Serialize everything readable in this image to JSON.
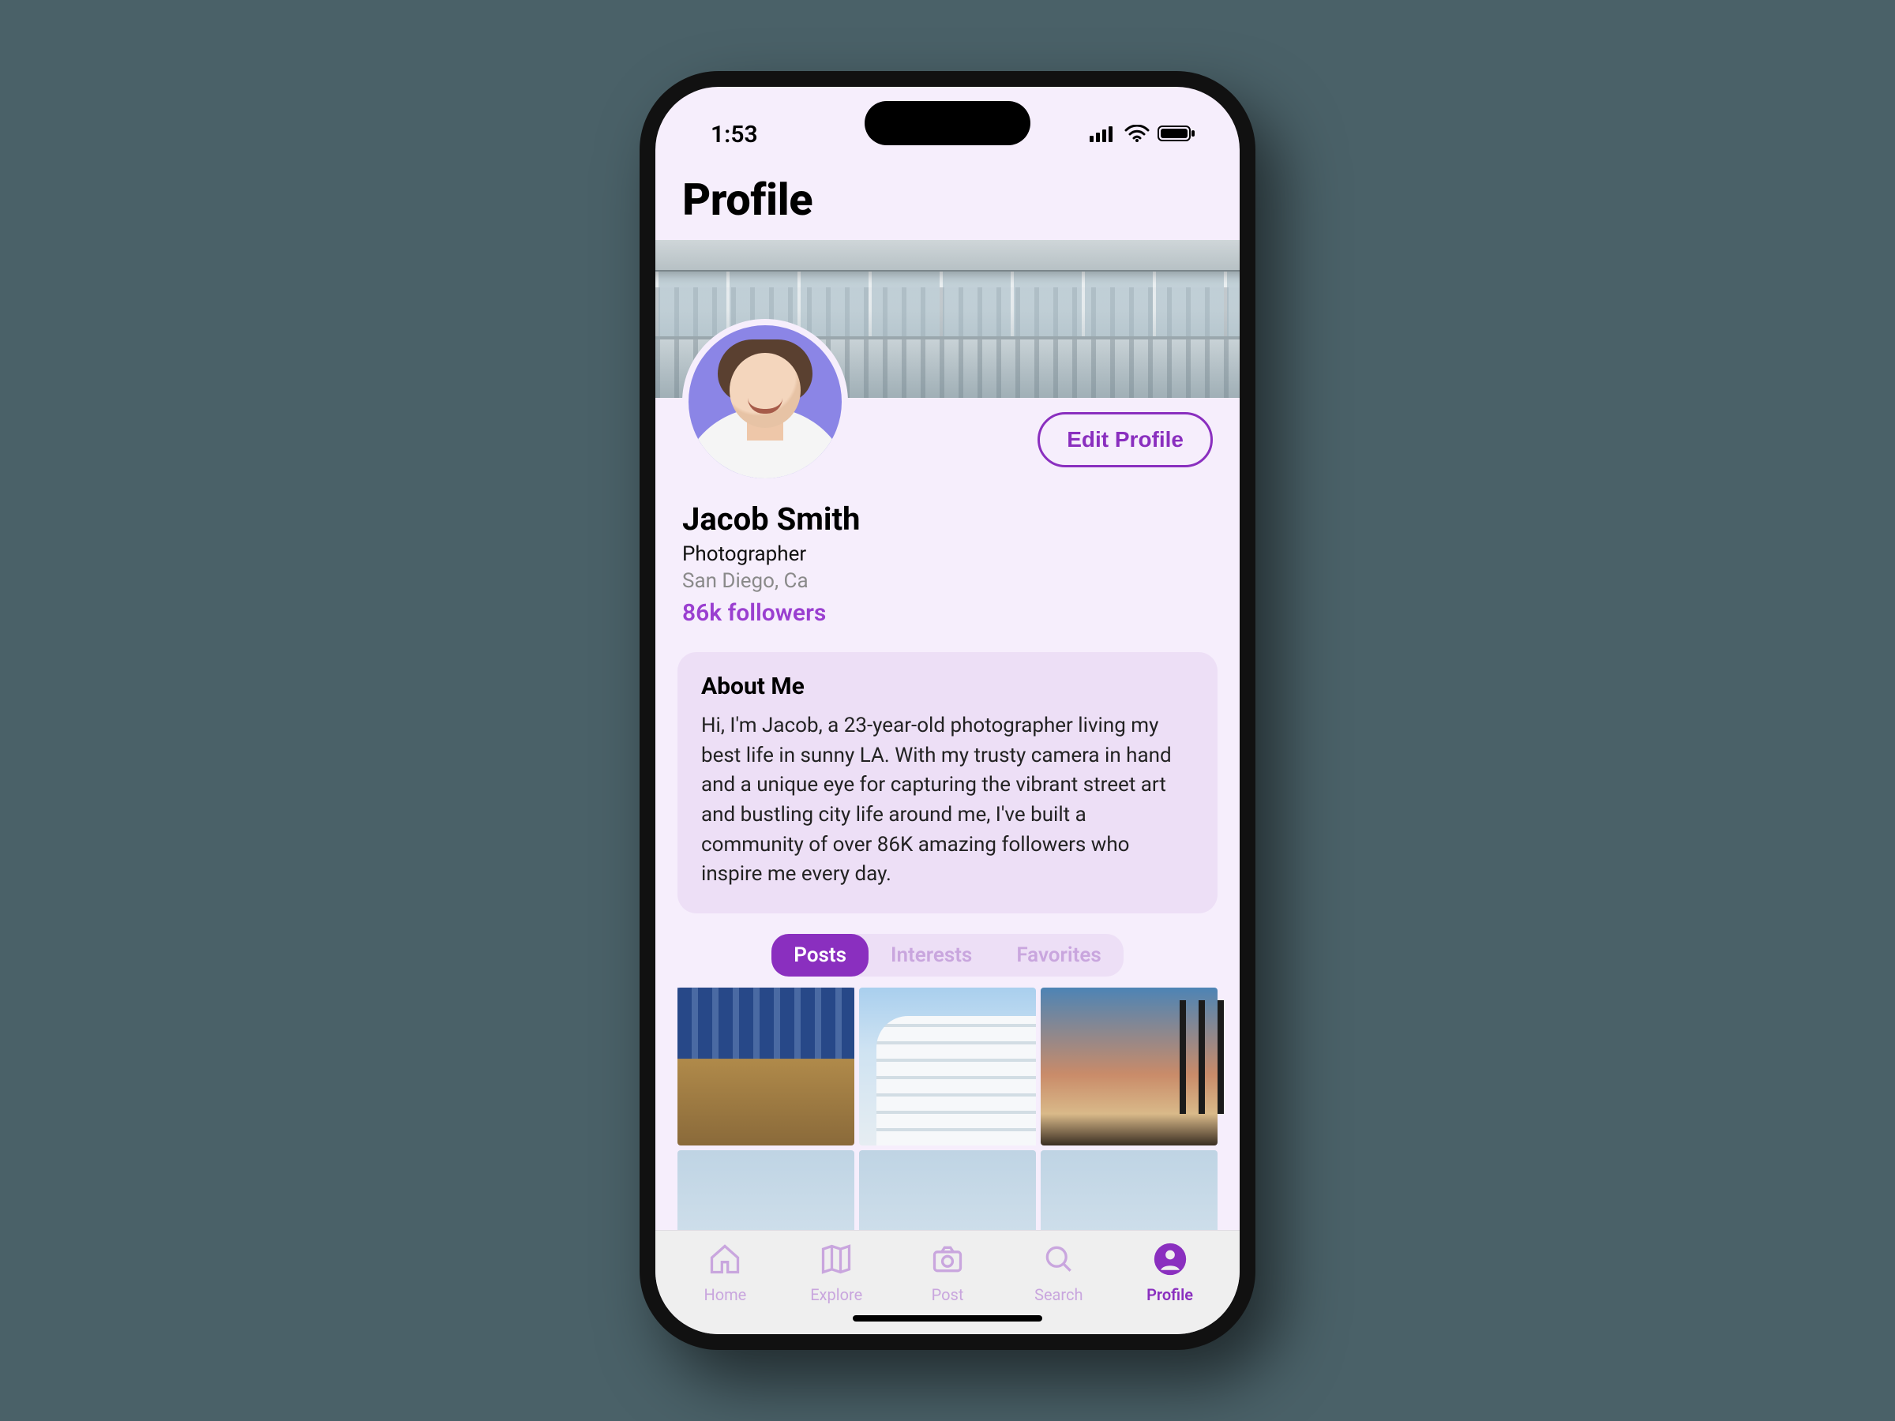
{
  "status": {
    "time": "1:53"
  },
  "header": {
    "title": "Profile"
  },
  "profile": {
    "edit_label": "Edit Profile",
    "name": "Jacob Smith",
    "role": "Photographer",
    "location": "San Diego, Ca",
    "followers": "86k followers"
  },
  "about": {
    "heading": "About Me",
    "body": "Hi, I'm Jacob, a 23-year-old photographer living my best life in sunny LA. With my trusty camera in hand and a unique eye for capturing the vibrant street art and bustling city life around me, I've built a community of over 86K amazing followers who inspire me every day."
  },
  "tabs": {
    "items": [
      "Posts",
      "Interests",
      "Favorites"
    ],
    "active_index": 0
  },
  "bottom_nav": {
    "items": [
      {
        "label": "Home",
        "icon": "home-icon"
      },
      {
        "label": "Explore",
        "icon": "map-icon"
      },
      {
        "label": "Post",
        "icon": "camera-icon"
      },
      {
        "label": "Search",
        "icon": "search-icon"
      },
      {
        "label": "Profile",
        "icon": "person-icon"
      }
    ],
    "active_index": 4
  },
  "colors": {
    "accent": "#8a2fbf",
    "bg": "#f6eefc",
    "card": "#eddff6",
    "muted_text": "#c9a6de"
  }
}
